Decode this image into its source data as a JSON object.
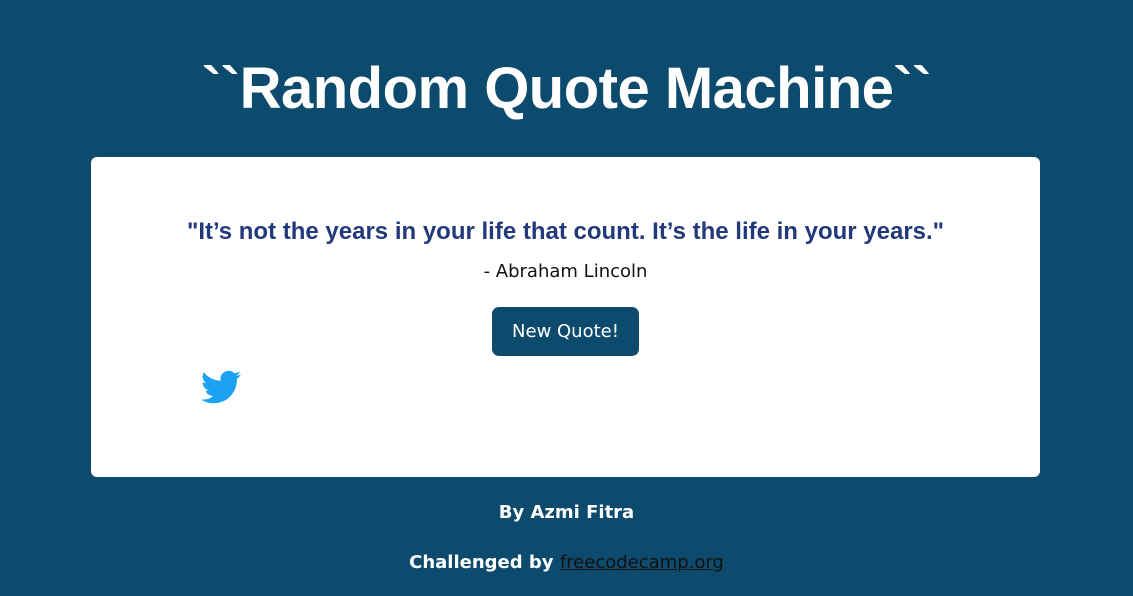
{
  "page": {
    "title": "``Random Quote Machine``"
  },
  "quote": {
    "text": "\"It’s not the years in your life that count. It’s the life in your years.\"",
    "author": "- Abraham Lincoln"
  },
  "actions": {
    "new_quote_label": "New Quote!",
    "tweet_icon": "twitter-icon"
  },
  "footer": {
    "by": "By Azmi Fitra",
    "challenged_prefix": "Challenged by",
    "link_text": "freecodecamp.org"
  },
  "colors": {
    "background": "#0d4b6e",
    "card": "#ffffff",
    "quote_text": "#233a7a",
    "button": "#0d4b6e",
    "twitter": "#1da1f2"
  }
}
